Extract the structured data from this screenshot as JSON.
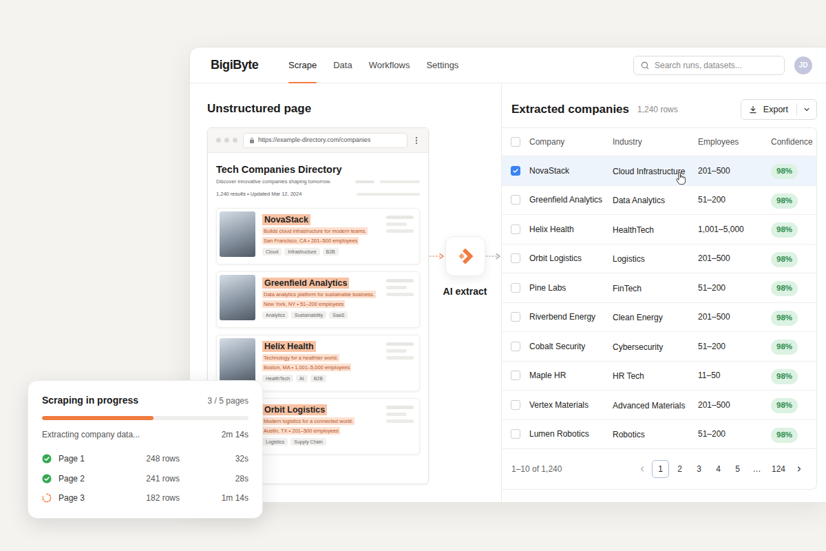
{
  "app": {
    "logo": "BigiByte",
    "avatar": "JD"
  },
  "tabs": [
    {
      "label": "Scrape",
      "selected": true
    },
    {
      "label": "Data",
      "selected": false
    },
    {
      "label": "Workflows",
      "selected": false
    },
    {
      "label": "Settings",
      "selected": false
    }
  ],
  "search": {
    "placeholder": "Search runs, datasets..."
  },
  "source": {
    "title": "Unstructured page",
    "url": "https://example-directory.com/companies",
    "heading": "Tech Companies Directory",
    "subtitle": "Discover innovative companies shaping tomorrow.",
    "meta": "1,240 results • Updated Mar 12, 2024",
    "cards": [
      {
        "name": "NovaStack",
        "description": "Builds cloud infrastructure for modern teams.",
        "details": "San Francisco, CA • 201–500 employees",
        "tags": [
          "Cloud",
          "Infrastructure",
          "B2B"
        ]
      },
      {
        "name": "Greenfield Analytics",
        "description": "Data analytics platform for sustainable business.",
        "details": "New York, NY • 51–200 employees",
        "tags": [
          "Analytics",
          "Sustainability",
          "SaaS"
        ]
      },
      {
        "name": "Helix Health",
        "description": "Technology for a healthier world.",
        "details": "Boston, MA • 1,001–5,000 employees",
        "tags": [
          "HealthTech",
          "AI",
          "B2B"
        ]
      },
      {
        "name": "Orbit Logistics",
        "description": "Modern logistics for a connected world.",
        "details": "Austin, TX • 201–500 employees",
        "tags": [
          "Logistics",
          "Supply Chain"
        ]
      }
    ]
  },
  "extract": {
    "label": "AI extract"
  },
  "table": {
    "title": "Extracted companies",
    "count": "1,240 rows",
    "export": "Export",
    "all_checked": false,
    "columns": [
      "Company",
      "Industry",
      "Employees",
      "Confidence"
    ],
    "rows": [
      {
        "cells": [
          "NovaStack",
          "Cloud Infrastructure",
          "201–500",
          "98%"
        ],
        "selected": true
      },
      {
        "cells": [
          "Greenfield Analytics",
          "Data Analytics",
          "51–200",
          "98%"
        ],
        "selected": false
      },
      {
        "cells": [
          "Helix Health",
          "HealthTech",
          "1,001–5,000",
          "98%"
        ],
        "selected": false
      },
      {
        "cells": [
          "Orbit Logistics",
          "Logistics",
          "201–500",
          "98%"
        ],
        "selected": false
      },
      {
        "cells": [
          "Pine Labs",
          "FinTech",
          "51–200",
          "98%"
        ],
        "selected": false
      },
      {
        "cells": [
          "Riverbend Energy",
          "Clean Energy",
          "201–500",
          "98%"
        ],
        "selected": false
      },
      {
        "cells": [
          "Cobalt Security",
          "Cybersecurity",
          "51–200",
          "98%"
        ],
        "selected": false
      },
      {
        "cells": [
          "Maple HR",
          "HR Tech",
          "11–50",
          "98%"
        ],
        "selected": false
      },
      {
        "cells": [
          "Vertex Materials",
          "Advanced Materials",
          "201–500",
          "98%"
        ],
        "selected": false
      },
      {
        "cells": [
          "Lumen Robotics",
          "Robotics",
          "51–200",
          "98%"
        ],
        "selected": false
      }
    ],
    "range": "1–10 of 1,240",
    "pages": [
      {
        "label": "1",
        "selected": true
      },
      {
        "label": "2",
        "selected": false
      },
      {
        "label": "3",
        "selected": false
      },
      {
        "label": "4",
        "selected": false
      },
      {
        "label": "5",
        "selected": false
      },
      {
        "label": "…",
        "selected": false
      },
      {
        "label": "124",
        "selected": false
      }
    ]
  },
  "progress": {
    "title": "Scraping in progress",
    "pages": "3 / 5 pages",
    "level": 0.54,
    "status": "Extracting company data...",
    "elapsed": "2m 14s",
    "steps": [
      {
        "label": "Page 1",
        "rows": "248 rows",
        "time": "32s",
        "done": true
      },
      {
        "label": "Page 2",
        "rows": "241 rows",
        "time": "28s",
        "done": true
      },
      {
        "label": "Page 3",
        "rows": "182 rows",
        "time": "1m 14s",
        "done": false
      }
    ]
  }
}
